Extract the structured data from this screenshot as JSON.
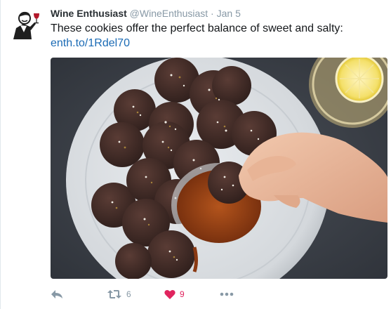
{
  "tweet": {
    "display_name": "Wine Enthusiast",
    "handle": "@WineEnthusiast",
    "separator": "·",
    "timestamp": "Jan 5",
    "text": "These cookies offer the perfect balance of sweet and salty:",
    "link_text": "enth.to/1Rdel70",
    "avatar_icon": "sommelier-logo-icon",
    "media_alt": "chocolate-salted-cookies-caramel-dip-photo"
  },
  "actions": {
    "reply_icon": "reply-icon",
    "retweet_icon": "retweet-icon",
    "retweet_count": "6",
    "like_icon": "heart-icon",
    "like_count": "9",
    "more_icon": "more-icon"
  },
  "colors": {
    "link": "#1b6bb5",
    "muted": "#8899a6",
    "like": "#e0245e",
    "text": "#14171a"
  }
}
